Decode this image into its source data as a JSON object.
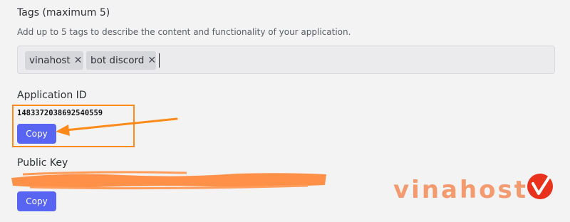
{
  "tags_section": {
    "title": "Tags (maximum 5)",
    "hint": "Add up to 5 tags to describe the content and functionality of your application.",
    "tags": [
      {
        "label": "vinahost",
        "remove_icon": "close-icon"
      },
      {
        "label": "bot discord",
        "remove_icon": "close-icon"
      }
    ],
    "remove_glyph": "✕"
  },
  "application_id": {
    "title": "Application ID",
    "value": "1483372038692540559",
    "copy_label": "Copy"
  },
  "public_key": {
    "title": "Public Key",
    "copy_label": "Copy"
  },
  "annotation": {
    "color": "#ff8a1a",
    "redaction_color": "#ff8a3d",
    "arrow_icon": "arrow-left-icon"
  },
  "watermark": {
    "text": "vinahost",
    "color": "#f39a6e",
    "mark_color": "#e8321e"
  },
  "colors": {
    "accent": "#5865f2",
    "background": "#f3f3f4"
  }
}
